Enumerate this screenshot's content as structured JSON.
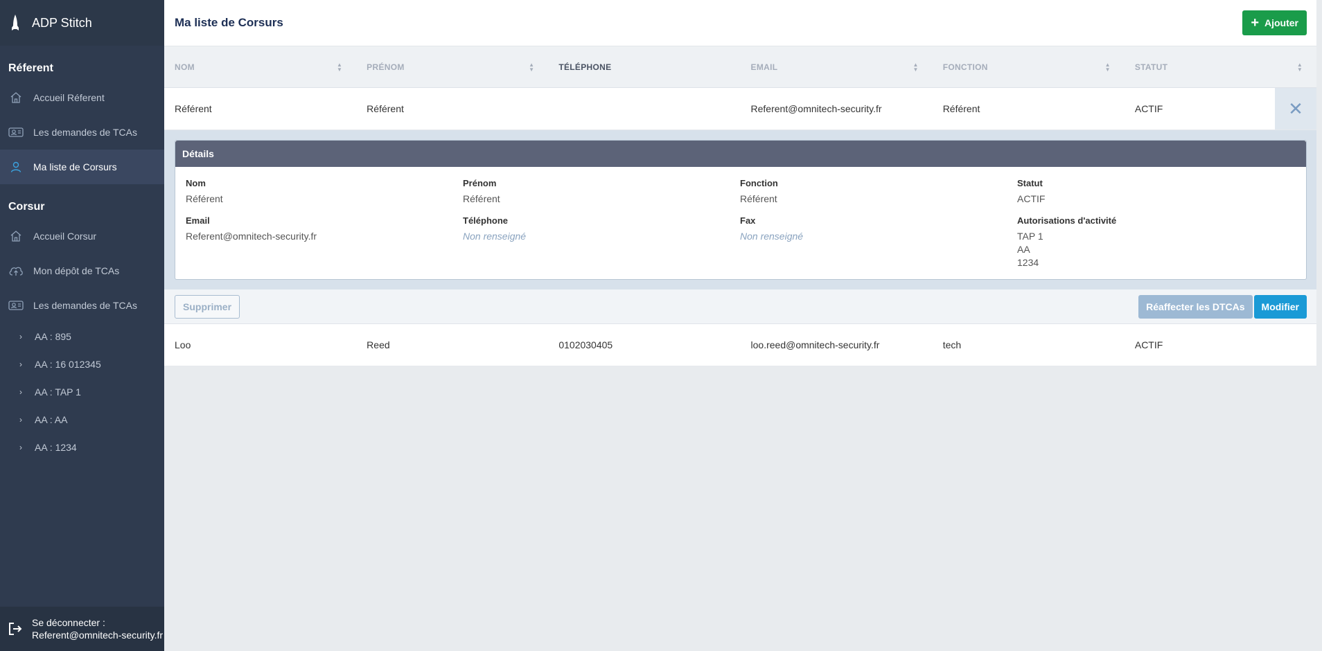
{
  "app": {
    "name": "ADP Stitch"
  },
  "sidebar": {
    "referent_section": "Réferent",
    "referent_items": [
      {
        "label": "Accueil Réferent",
        "icon": "home-icon"
      },
      {
        "label": "Les demandes de TCAs",
        "icon": "id-card-icon"
      },
      {
        "label": "Ma liste de Corsurs",
        "icon": "user-icon",
        "active": true
      }
    ],
    "corsur_section": "Corsur",
    "corsur_items": [
      {
        "label": "Accueil Corsur",
        "icon": "home-icon"
      },
      {
        "label": "Mon dépôt de TCAs",
        "icon": "cloud-upload-icon"
      },
      {
        "label": "Les demandes de TCAs",
        "icon": "id-card-icon"
      }
    ],
    "sub_items": [
      {
        "label": "AA : 895"
      },
      {
        "label": "AA : 16 012345"
      },
      {
        "label": "AA : TAP 1"
      },
      {
        "label": "AA : AA"
      },
      {
        "label": "AA : 1234"
      }
    ],
    "logout": {
      "line1": "Se déconnecter :",
      "line2": "Referent@omnitech-security.fr"
    }
  },
  "header": {
    "title": "Ma liste de Corsurs",
    "add_label": "Ajouter"
  },
  "table": {
    "columns": [
      "NOM",
      "PRÉNOM",
      "TÉLÉPHONE",
      "EMAIL",
      "FONCTION",
      "STATUT"
    ],
    "rows": [
      {
        "nom": "Référent",
        "prenom": "Référent",
        "telephone": "",
        "email": "Referent@omnitech-security.fr",
        "fonction": "Référent",
        "statut": "ACTIF"
      },
      {
        "nom": "Loo",
        "prenom": "Reed",
        "telephone": "0102030405",
        "email": "loo.reed@omnitech-security.fr",
        "fonction": "tech",
        "statut": "ACTIF"
      }
    ]
  },
  "details": {
    "title": "Détails",
    "nom_label": "Nom",
    "nom": "Référent",
    "prenom_label": "Prénom",
    "prenom": "Référent",
    "fonction_label": "Fonction",
    "fonction": "Référent",
    "statut_label": "Statut",
    "statut": "ACTIF",
    "email_label": "Email",
    "email": "Referent@omnitech-security.fr",
    "telephone_label": "Téléphone",
    "telephone": "Non renseigné",
    "fax_label": "Fax",
    "fax": "Non renseigné",
    "autorisations_label": "Autorisations d'activité",
    "autorisations": [
      "TAP 1",
      "AA",
      "1234"
    ]
  },
  "actions": {
    "delete_label": "Supprimer",
    "reaffect_label": "Réaffecter les DTCAs",
    "modify_label": "Modifier"
  },
  "colors": {
    "sidebar_bg": "#2f3b4f",
    "accent_green": "#1a9c4a",
    "accent_blue": "#1a9ad6",
    "details_header": "#5c6378"
  }
}
